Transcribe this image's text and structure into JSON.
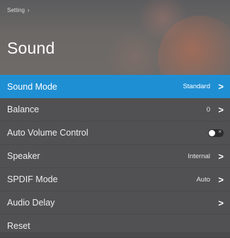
{
  "breadcrumb": {
    "parent": "Setting",
    "separator": "›"
  },
  "page_title": "Sound",
  "menu": {
    "items": [
      {
        "label": "Sound Mode",
        "value": "Standard",
        "chevron": ">"
      },
      {
        "label": "Balance",
        "value": "0",
        "chevron": ">"
      },
      {
        "label": "Auto Volume Control",
        "toggle_state": "off",
        "toggle_mark": "×"
      },
      {
        "label": "Speaker",
        "value": "Internal",
        "chevron": ">"
      },
      {
        "label": "SPDIF Mode",
        "value": "Auto",
        "chevron": ">"
      },
      {
        "label": "Audio Delay",
        "chevron": ">"
      },
      {
        "label": "Reset"
      }
    ],
    "selected_index": 0
  },
  "colors": {
    "selected_row": "#1f8fd4",
    "panel_bg": "#515153",
    "text": "#ececec"
  }
}
